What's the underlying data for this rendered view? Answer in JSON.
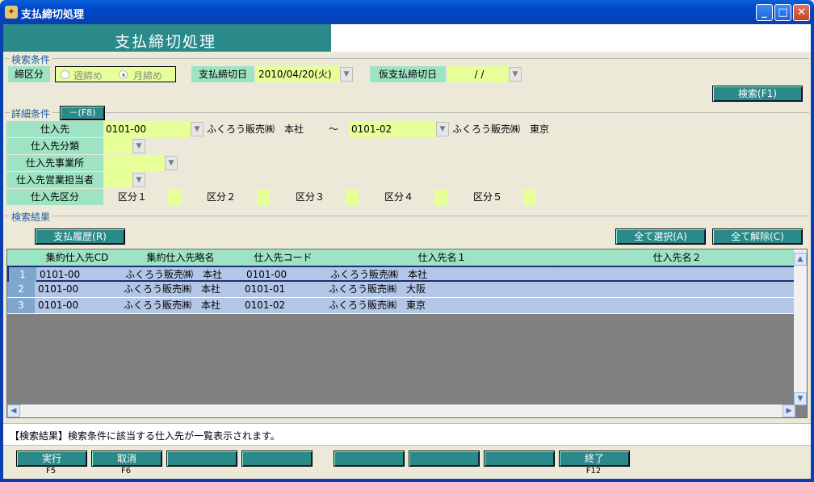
{
  "window": {
    "title": "支払締切処理",
    "header_title": "支払締切処理"
  },
  "search_conditions": {
    "section_label": "検索条件",
    "closing_type_label": "締区分",
    "options": [
      {
        "label": "週締め",
        "checked": false
      },
      {
        "label": "月締め",
        "checked": true
      }
    ],
    "closing_date_label": "支払締切日",
    "closing_date_value": "2010/04/20(火)",
    "temp_closing_date_label": "仮支払締切日",
    "temp_closing_date_value": "/ /",
    "search_button": "検索(F1)"
  },
  "detail_conditions": {
    "section_label": "詳細条件",
    "collapse_button": "－(F8)",
    "supplier_label": "仕入先",
    "supplier_from_code": "0101-00",
    "supplier_from_name": "ふくろう販売㈱　本社",
    "range_sep": "～",
    "supplier_to_code": "0101-02",
    "supplier_to_name": "ふくろう販売㈱　東京",
    "category_label": "仕入先分類",
    "office_label": "仕入先事業所",
    "staff_label": "仕入先営業担当者",
    "division_label": "仕入先区分",
    "divisions": [
      "区分１",
      "区分２",
      "区分３",
      "区分４",
      "区分５"
    ]
  },
  "results": {
    "section_label": "検索結果",
    "history_button": "支払履歴(R)",
    "select_all_button": "全て選択(A)",
    "clear_all_button": "全て解除(C)",
    "columns": [
      "集約仕入先CD",
      "集約仕入先略名",
      "仕入先コード",
      "仕入先名１",
      "仕入先名２"
    ],
    "rows": [
      {
        "num": "1",
        "agg_code": "0101-00",
        "agg_name": "ふくろう販売㈱　本社",
        "code": "0101-00",
        "name1": "ふくろう販売㈱　本社",
        "name2": ""
      },
      {
        "num": "2",
        "agg_code": "0101-00",
        "agg_name": "ふくろう販売㈱　本社",
        "code": "0101-01",
        "name1": "ふくろう販売㈱　大阪",
        "name2": ""
      },
      {
        "num": "3",
        "agg_code": "0101-00",
        "agg_name": "ふくろう販売㈱　本社",
        "code": "0101-02",
        "name1": "ふくろう販売㈱　東京",
        "name2": ""
      }
    ]
  },
  "status_message": "【検索結果】検索条件に該当する仕入先が一覧表示されます。",
  "function_keys": [
    {
      "label": "実行",
      "key": "F5"
    },
    {
      "label": "取消",
      "key": "F6"
    },
    {
      "label": "",
      "key": ""
    },
    {
      "label": "",
      "key": ""
    },
    {
      "label": "",
      "key": ""
    },
    {
      "label": "",
      "key": ""
    },
    {
      "label": "",
      "key": ""
    },
    {
      "label": "終了",
      "key": "F12"
    }
  ]
}
